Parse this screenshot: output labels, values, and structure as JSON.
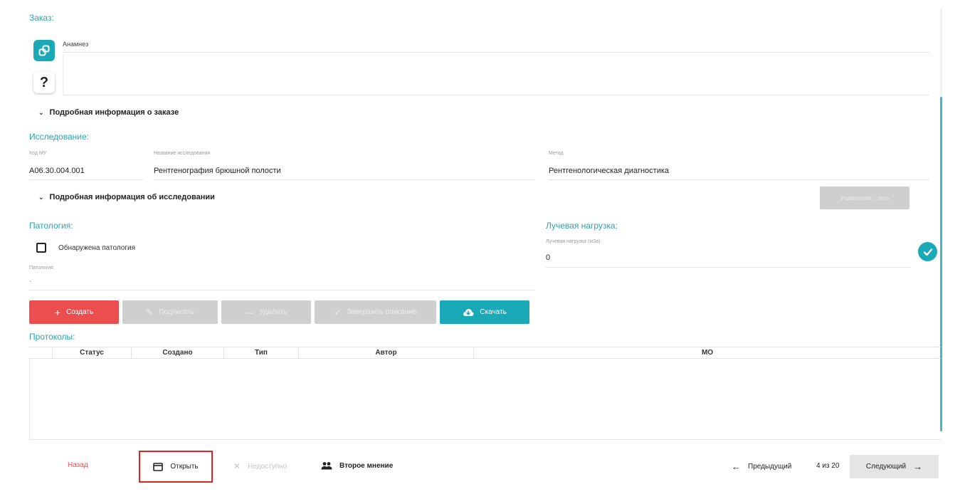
{
  "order": {
    "section_title": "Заказ:",
    "anamnesis_label": "Анамнез",
    "anamnesis_value": "",
    "help_glyph": "?",
    "details_label": "Подробная информация о заказе"
  },
  "study": {
    "section_title": "Исследование:",
    "code_label": "Код МУ",
    "code_value": "A06.30.004.001",
    "name_label": "Название исследования",
    "name_value": "Рентгенография брюшной полости",
    "method_label": "Метод",
    "method_value": "Рентгенологическая диагностика",
    "details_label": "Подробная информация об исследовании",
    "disabled_button_label": "Управление ...тать"
  },
  "pathology": {
    "section_title": "Патология:",
    "checkbox_label": "Обнаружена патология",
    "field_label": "Патология",
    "field_value": "-"
  },
  "radiation": {
    "section_title": "Лучевая нагрузка:",
    "field_label": "Лучевая нагрузка (мЗв)",
    "field_value": "0"
  },
  "actions": {
    "create": "Создать",
    "sign": "Подписать",
    "delete": "Удалить",
    "finish": "Завершить описание",
    "download": "Скачать"
  },
  "protocols": {
    "section_title": "Протоколы:",
    "columns": [
      "",
      "Статус",
      "Создано",
      "Тип",
      "Автор",
      "МО"
    ]
  },
  "footer": {
    "back": "Назад",
    "open": "Открыть",
    "unavailable": "Недоступно",
    "second_opinion": "Второе мнение",
    "previous": "Предыдущий",
    "counter": "4 из 20",
    "next": "Следующий"
  },
  "colors": {
    "accent": "#1aa9b7",
    "danger": "#ea4e4e",
    "highlight_border": "#e0231f"
  }
}
